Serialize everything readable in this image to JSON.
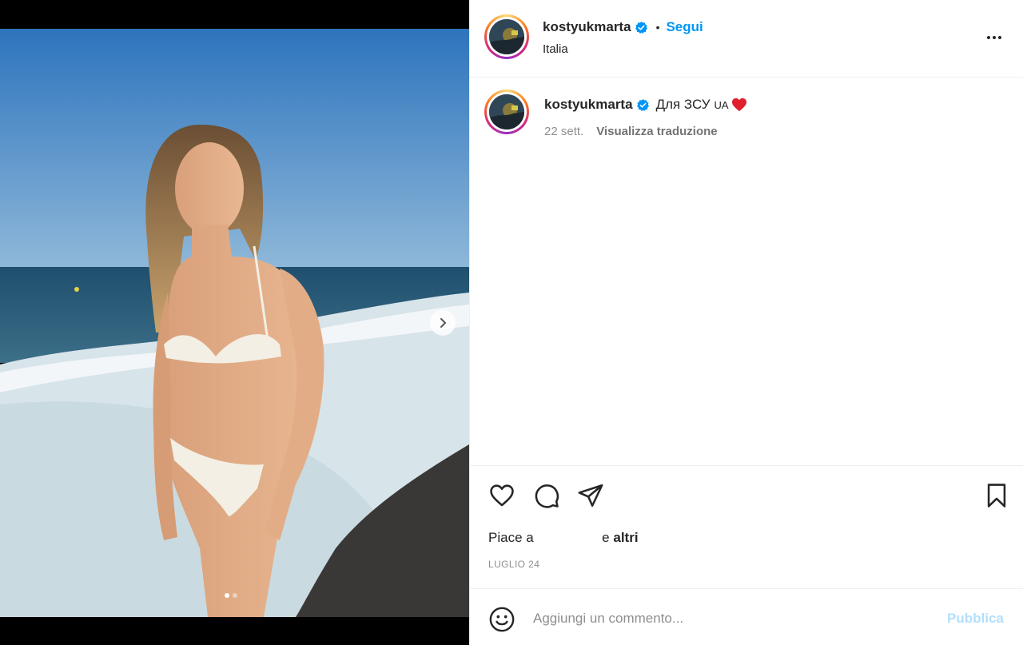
{
  "post": {
    "username": "kostyukmarta",
    "separator": "•",
    "follow_label": "Segui",
    "location": "Italia",
    "more_icon": "more-options-icon"
  },
  "caption": {
    "username": "kostyukmarta",
    "text": "Для ЗСУ",
    "flag_text": "UA",
    "time_ago": "22 sett.",
    "translate_label": "Visualizza traduzione"
  },
  "media": {
    "next_icon": "chevron-right-icon",
    "slide_count": 2,
    "active_slide": 1
  },
  "actions": {
    "icons": [
      "heart-icon",
      "comment-icon",
      "share-icon",
      "bookmark-icon"
    ]
  },
  "likes": {
    "prefix": "Piace a",
    "middle": "e",
    "others": "altri"
  },
  "date": "LUGLIO 24",
  "comment": {
    "placeholder": "Aggiungi un commento...",
    "publish_label": "Pubblica"
  },
  "colors": {
    "link_blue": "#0095f6",
    "publish_disabled": "#b2dffc",
    "muted": "#8e8e8e",
    "verified": "#0095f6"
  }
}
